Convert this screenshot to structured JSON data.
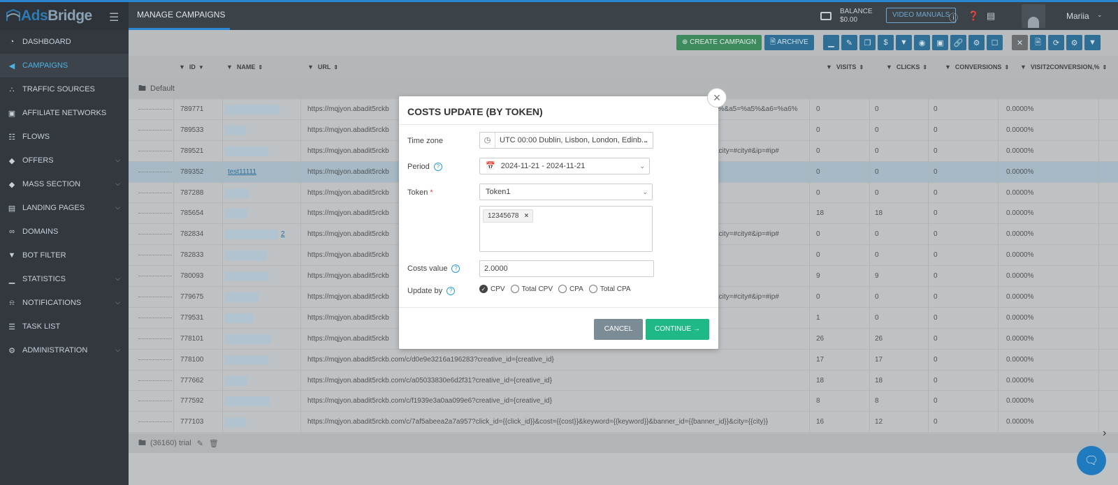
{
  "brand": {
    "name_a": "Ads",
    "name_b": "Bridge"
  },
  "colors": {
    "accent": "#2a86d1",
    "green": "#1fb887",
    "sidebar": "#32383e"
  },
  "sidebar": {
    "items": [
      {
        "label": "DASHBOARD",
        "icon": "dashboard-icon"
      },
      {
        "label": "CAMPAIGNS",
        "icon": "megaphone-icon",
        "active": true
      },
      {
        "label": "TRAFFIC SOURCES",
        "icon": "share-icon"
      },
      {
        "label": "AFFILIATE NETWORKS",
        "icon": "briefcase-icon"
      },
      {
        "label": "FLOWS",
        "icon": "sitemap-icon"
      },
      {
        "label": "OFFERS",
        "icon": "tag-icon",
        "chevron": true
      },
      {
        "label": "MASS SECTION",
        "icon": "tags-icon",
        "chevron": true
      },
      {
        "label": "LANDING PAGES",
        "icon": "browser-icon",
        "chevron": true
      },
      {
        "label": "DOMAINS",
        "icon": "link-icon"
      },
      {
        "label": "BOT FILTER",
        "icon": "filter-icon"
      },
      {
        "label": "STATISTICS",
        "icon": "bar-chart-icon",
        "chevron": true
      },
      {
        "label": "NOTIFICATIONS",
        "icon": "bell-icon",
        "chevron": true
      },
      {
        "label": "TASK LIST",
        "icon": "list-icon"
      },
      {
        "label": "ADMINISTRATION",
        "icon": "gear-icon",
        "chevron": true
      }
    ]
  },
  "topbar": {
    "title": "MANAGE CAMPAIGNS",
    "balance_label": "BALANCE",
    "balance_value": "$0.00",
    "video_manuals": "VIDEO MANUALS",
    "user": "Mariia"
  },
  "toolbar": {
    "create": "CREATE CAMPAIGN",
    "archive": "ARCHIVE"
  },
  "table": {
    "headers": {
      "id": "ID",
      "name": "NAME",
      "url": "URL",
      "visits": "VISITS",
      "clicks": "CLICKS",
      "conversions": "CONVERSIONS",
      "v2c": "VISIT2CONVERSION,%"
    },
    "group": "Default",
    "footer": "(36160) trial",
    "rows": [
      {
        "id": "789771",
        "name": "",
        "url": "https://mqjyon.abadit5rckb",
        "urltail": "4%&a5=%a5%&a6=%a6%",
        "visits": "0",
        "clicks": "0",
        "conv": "0",
        "v2c": "0.0000%"
      },
      {
        "id": "789533",
        "name": "",
        "url": "https://mqjyon.abadit5rckb",
        "urltail": "",
        "visits": "0",
        "clicks": "0",
        "conv": "0",
        "v2c": "0.0000%"
      },
      {
        "id": "789521",
        "name": "",
        "url": "https://mqjyon.abadit5rckb",
        "urltail": "&city=#city#&ip=#ip#",
        "visits": "0",
        "clicks": "0",
        "conv": "0",
        "v2c": "0.0000%"
      },
      {
        "id": "789352",
        "name": "test11111",
        "url": "https://mqjyon.abadit5rckb",
        "urltail": "",
        "visits": "0",
        "clicks": "0",
        "conv": "0",
        "v2c": "0.0000%",
        "hl": true
      },
      {
        "id": "787288",
        "name": "",
        "url": "https://mqjyon.abadit5rckb",
        "urltail": "",
        "visits": "0",
        "clicks": "0",
        "conv": "0",
        "v2c": "0.0000%"
      },
      {
        "id": "785654",
        "name": "",
        "url": "https://mqjyon.abadit5rckb",
        "urltail": "",
        "visits": "18",
        "clicks": "18",
        "conv": "0",
        "v2c": "0.0000%"
      },
      {
        "id": "782834",
        "name": "2",
        "url": "https://mqjyon.abadit5rckb",
        "urltail": "&city=#city#&ip=#ip#",
        "visits": "0",
        "clicks": "0",
        "conv": "0",
        "v2c": "0.0000%"
      },
      {
        "id": "782833",
        "name": "",
        "url": "https://mqjyon.abadit5rckb",
        "urltail": "",
        "visits": "0",
        "clicks": "0",
        "conv": "0",
        "v2c": "0.0000%"
      },
      {
        "id": "780093",
        "name": "",
        "url": "https://mqjyon.abadit5rckb",
        "urltail": "",
        "visits": "9",
        "clicks": "9",
        "conv": "0",
        "v2c": "0.0000%"
      },
      {
        "id": "779675",
        "name": "",
        "url": "https://mqjyon.abadit5rckb",
        "urltail": "&city=#city#&ip=#ip#",
        "visits": "0",
        "clicks": "0",
        "conv": "0",
        "v2c": "0.0000%"
      },
      {
        "id": "779531",
        "name": "",
        "url": "https://mqjyon.abadit5rckb",
        "urltail": "",
        "visits": "1",
        "clicks": "0",
        "conv": "0",
        "v2c": "0.0000%"
      },
      {
        "id": "778101",
        "name": "",
        "url": "https://mqjyon.abadit5rckb",
        "urltail": "",
        "visits": "26",
        "clicks": "26",
        "conv": "0",
        "v2c": "0.0000%"
      },
      {
        "id": "778100",
        "name": "",
        "url": "https://mqjyon.abadit5rckb.com/c/d0e9e3216a196283?creative_id={creative_id}",
        "urltail": "",
        "visits": "17",
        "clicks": "17",
        "conv": "0",
        "v2c": "0.0000%"
      },
      {
        "id": "777662",
        "name": "",
        "url": "https://mqjyon.abadit5rckb.com/c/a05033830e6d2f31?creative_id={creative_id}",
        "urltail": "",
        "visits": "18",
        "clicks": "18",
        "conv": "0",
        "v2c": "0.0000%"
      },
      {
        "id": "777592",
        "name": "",
        "url": "https://mqjyon.abadit5rckb.com/c/f1939e3a0aa099e6?creative_id={creative_id}",
        "urltail": "",
        "visits": "8",
        "clicks": "8",
        "conv": "0",
        "v2c": "0.0000%"
      },
      {
        "id": "777103",
        "name": "",
        "url": "https://mqjyon.abadit5rckb.com/c/7af5abeea2a7a957?click_id={{click_id}}&cost={{cost}}&keyword={{keyword}}&banner_id={{banner_id}}&city={{city}}",
        "urltail": "",
        "visits": "16",
        "clicks": "12",
        "conv": "0",
        "v2c": "0.0000%"
      }
    ]
  },
  "modal": {
    "title": "COSTS UPDATE (BY TOKEN)",
    "timezone_label": "Time zone",
    "timezone_value": "UTC 00:00 Dublin, Lisbon, London, Edinb...",
    "period_label": "Period",
    "period_value": "2024-11-21 - 2024-11-21",
    "token_label": "Token",
    "token_value": "Token1",
    "token_chip": "12345678",
    "costs_label": "Costs value",
    "costs_value": "2.0000",
    "update_label": "Update by",
    "options": [
      "CPV",
      "Total CPV",
      "CPA",
      "Total CPA"
    ],
    "selected": "CPV",
    "cancel": "CANCEL",
    "continue": "CONTINUE →"
  }
}
